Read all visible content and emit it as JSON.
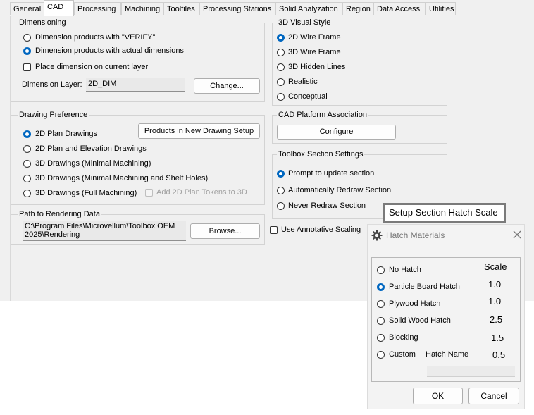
{
  "tabs": [
    "General",
    "CAD",
    "Processing",
    "Machining",
    "Toolfiles",
    "Processing Stations",
    "Solid Analyzation",
    "Region",
    "Data Access",
    "Utilities"
  ],
  "active_tab": "CAD",
  "dimensioning": {
    "title": "Dimensioning",
    "options": [
      "Dimension products with \"VERIFY\"",
      "Dimension products with actual dimensions"
    ],
    "selected": 1,
    "place_on_current_layer": "Place dimension on current layer",
    "layer_label": "Dimension Layer:",
    "layer_value": "2D_DIM",
    "change_button": "Change..."
  },
  "visual_style": {
    "title": "3D Visual Style",
    "options": [
      "2D Wire Frame",
      "3D Wire Frame",
      "3D Hidden Lines",
      "Realistic",
      "Conceptual"
    ],
    "selected": 0
  },
  "drawing_preference": {
    "title": "Drawing Preference",
    "options": [
      "2D Plan Drawings",
      "2D Plan and Elevation Drawings",
      "3D Drawings (Minimal Machining)",
      "3D Drawings (Minimal Machining and Shelf Holes)",
      "3D Drawings (Full Machining)"
    ],
    "selected": 0,
    "setup_button": "Products in New Drawing Setup",
    "add_tokens_label": "Add 2D Plan Tokens to 3D"
  },
  "cad_platform": {
    "title": "CAD Platform Association",
    "configure_button": "Configure"
  },
  "toolbox_section": {
    "title": "Toolbox Section Settings",
    "options": [
      "Prompt to update section",
      "Automatically Redraw Section",
      "Never Redraw Section"
    ],
    "selected": 0
  },
  "rendering": {
    "title": "Path to Rendering Data",
    "path": "C:\\Program Files\\Microvellum\\Toolbox OEM 2025\\Rendering",
    "path_line1": "C:\\Program Files\\Microvellum\\Toolbox OEM",
    "path_line2": "2025\\Rendering",
    "browse_button": "Browse..."
  },
  "use_annotative_scaling": "Use Annotative Scaling",
  "callout": "Setup Section Hatch Scale",
  "hatch_dialog": {
    "title": "Hatch Materials",
    "scale_header": "Scale",
    "items": [
      {
        "label": "No Hatch",
        "scale": ""
      },
      {
        "label": "Particle Board Hatch",
        "scale": "1.0"
      },
      {
        "label": "Plywood Hatch",
        "scale": "1.0"
      },
      {
        "label": "Solid Wood Hatch",
        "scale": "2.5"
      },
      {
        "label": "Blocking",
        "scale": "1.5"
      },
      {
        "label": "Custom",
        "scale": "0.5"
      }
    ],
    "selected": 1,
    "hatch_name_label": "Hatch Name",
    "hatch_name_value": "",
    "ok_button": "OK",
    "cancel_button": "Cancel"
  },
  "colors": {
    "accent": "#0067c0",
    "panel": "#f0f0f0"
  }
}
